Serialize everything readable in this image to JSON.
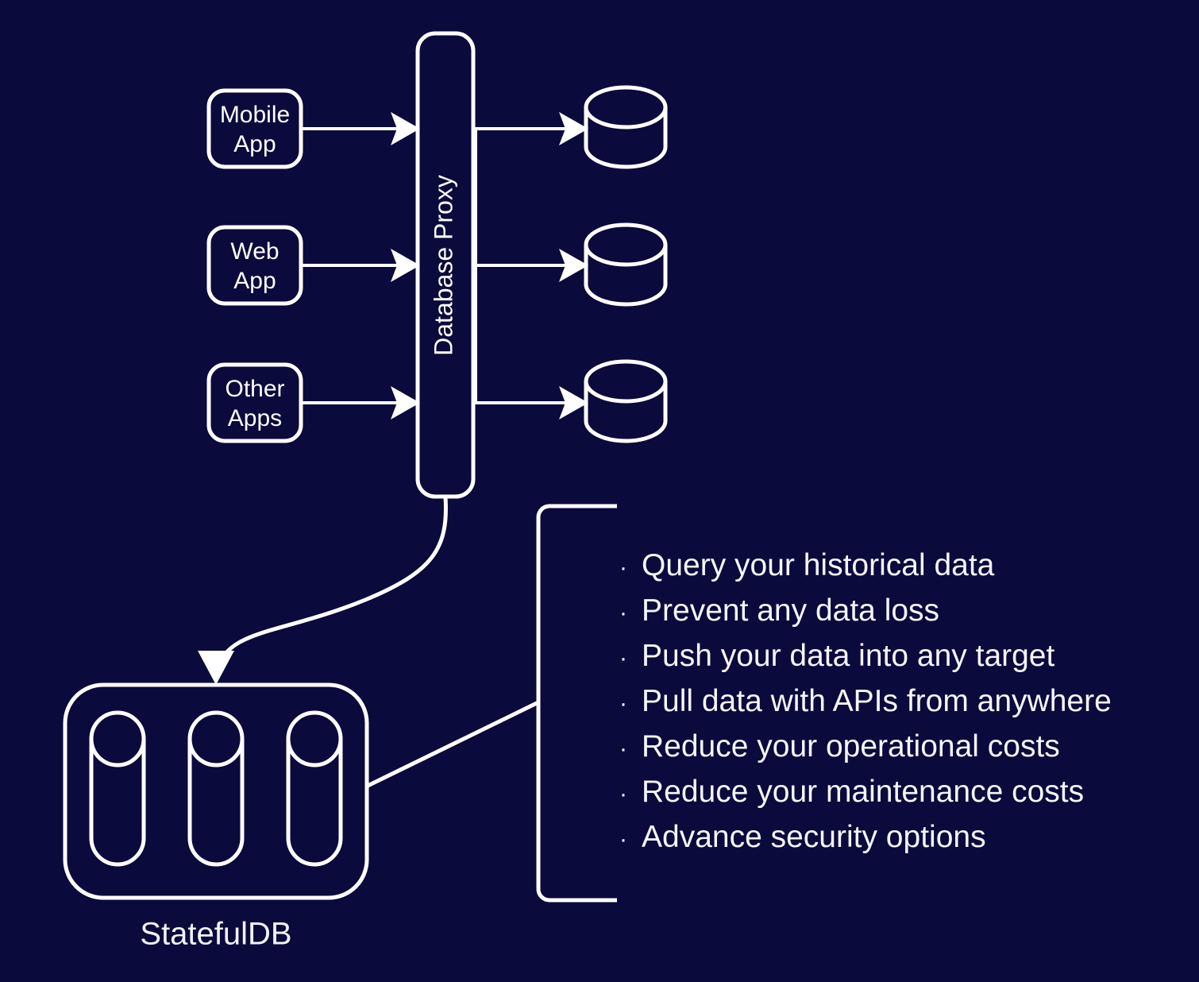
{
  "background_color": "#0a0a3c",
  "stroke_color": "#ffffff",
  "text_color": "#f5f5fa",
  "clients": [
    {
      "id": "mobile-app",
      "line1": "Mobile",
      "line2": "App"
    },
    {
      "id": "web-app",
      "line1": "Web",
      "line2": "App"
    },
    {
      "id": "other-apps",
      "line1": "Other",
      "line2": "Apps"
    }
  ],
  "proxy": {
    "label": "Database Proxy"
  },
  "databases": [
    {
      "id": "database-1",
      "icon": "database-cylinder-icon"
    },
    {
      "id": "database-2",
      "icon": "database-cylinder-icon"
    },
    {
      "id": "database-3",
      "icon": "database-cylinder-icon"
    }
  ],
  "cluster": {
    "label": "StatefulDB",
    "nodes": [
      {
        "id": "statefuldb-node-1",
        "icon": "vertical-cylinder-icon"
      },
      {
        "id": "statefuldb-node-2",
        "icon": "vertical-cylinder-icon"
      },
      {
        "id": "statefuldb-node-3",
        "icon": "vertical-cylinder-icon"
      }
    ]
  },
  "benefits": {
    "bullet_glyph": "·",
    "items": [
      "Query your historical data",
      "Prevent any data loss",
      "Push your data into any target",
      "Pull data with APIs from anywhere",
      "Reduce your operational costs",
      "Reduce your maintenance costs",
      "Advance security options"
    ]
  }
}
